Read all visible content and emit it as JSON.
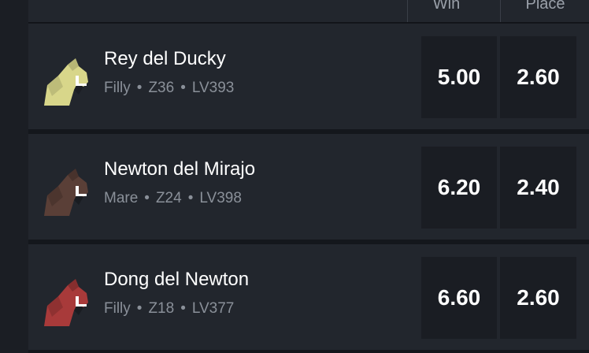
{
  "header": {
    "win_label": "Win",
    "place_label": "Place"
  },
  "runners": [
    {
      "name": "Rey del Ducky",
      "type": "Filly",
      "zone": "Z36",
      "level": "LV393",
      "win": "5.00",
      "place": "2.60",
      "color": "#d8d68a",
      "icon": "horse-head-icon"
    },
    {
      "name": "Newton del Mirajo",
      "type": "Mare",
      "zone": "Z24",
      "level": "LV398",
      "win": "6.20",
      "place": "2.40",
      "color": "#5a3f37",
      "icon": "horse-head-icon"
    },
    {
      "name": "Dong del Newton",
      "type": "Filly",
      "zone": "Z18",
      "level": "LV377",
      "win": "6.60",
      "place": "2.60",
      "color": "#a83a3a",
      "icon": "horse-head-icon"
    }
  ]
}
